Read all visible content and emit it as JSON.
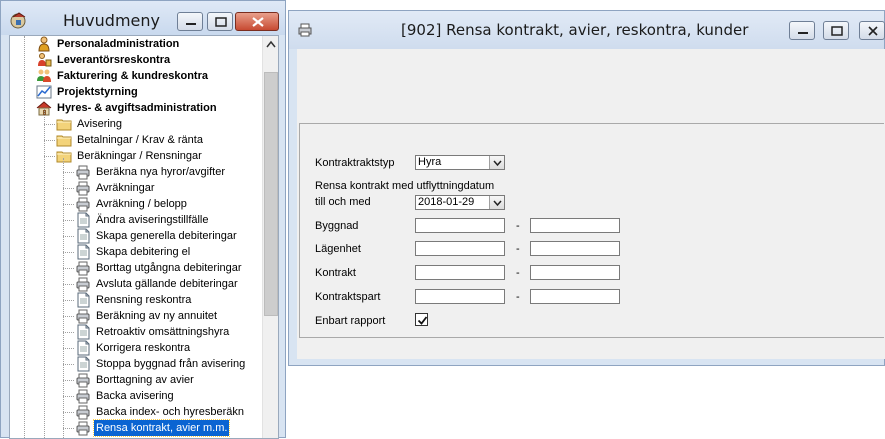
{
  "menu_window": {
    "title": "Huvudmeny",
    "tree": [
      {
        "label": "Personaladministration",
        "icon": "person-icon",
        "bold": true
      },
      {
        "label": "Leverantörsreskontra",
        "icon": "supplier-icon",
        "bold": true
      },
      {
        "label": "Fakturering & kundreskontra",
        "icon": "customers-icon",
        "bold": true
      },
      {
        "label": "Projektstyrning",
        "icon": "project-chart-icon",
        "bold": true
      },
      {
        "label": "Hyres- & avgiftsadministration",
        "icon": "house-icon",
        "bold": true
      },
      {
        "label": "Avisering",
        "icon": "folder-icon"
      },
      {
        "label": "Betalningar / Krav & ränta",
        "icon": "folder-icon"
      },
      {
        "label": "Beräkningar / Rensningar",
        "icon": "folder-icon"
      },
      {
        "label": "Beräkna nya hyror/avgifter",
        "icon": "printer-icon"
      },
      {
        "label": "Avräkningar",
        "icon": "printer-icon"
      },
      {
        "label": "Avräkning / belopp",
        "icon": "printer-icon"
      },
      {
        "label": "Ändra aviseringstillfälle",
        "icon": "document-icon"
      },
      {
        "label": "Skapa generella debiteringar",
        "icon": "document-icon"
      },
      {
        "label": "Skapa debitering el",
        "icon": "document-icon"
      },
      {
        "label": "Borttag utgångna debiteringar",
        "icon": "printer-icon"
      },
      {
        "label": "Avsluta gällande debiteringar",
        "icon": "printer-icon"
      },
      {
        "label": "Rensning reskontra",
        "icon": "document-icon"
      },
      {
        "label": "Beräkning av ny annuitet",
        "icon": "printer-icon"
      },
      {
        "label": "Retroaktiv omsättningshyra",
        "icon": "document-icon"
      },
      {
        "label": "Korrigera reskontra",
        "icon": "document-icon"
      },
      {
        "label": "Stoppa byggnad från avisering",
        "icon": "document-icon"
      },
      {
        "label": "Borttagning av avier",
        "icon": "printer-icon"
      },
      {
        "label": "Backa avisering",
        "icon": "printer-icon"
      },
      {
        "label": "Backa index- och hyresberäkn",
        "icon": "printer-icon"
      },
      {
        "label": "Rensa kontrakt, avier m.m.",
        "icon": "printer-icon",
        "selected": true
      }
    ]
  },
  "dialog": {
    "title": "[902]  Rensa kontrakt, avier, reskontra, kunder",
    "fields": {
      "kontraktstyp_label": "Kontraktraktstyp",
      "kontraktstyp_value": "Hyra",
      "datum_label_line1": "Rensa kontrakt med utflyttningdatum",
      "datum_label_line2": "till och med",
      "datum_value": "2018-01-29",
      "byggnad_label": "Byggnad",
      "lagenhet_label": "Lägenhet",
      "kontrakt_label": "Kontrakt",
      "kontraktspart_label": "Kontraktspart",
      "range_separator": "-",
      "enbart_rapport_label": "Enbart rapport",
      "enbart_rapport_checked": true
    }
  },
  "colors": {
    "selection": "#0a64d2",
    "window_frame": "#d8e4f2",
    "close_button": "#c74a32"
  }
}
